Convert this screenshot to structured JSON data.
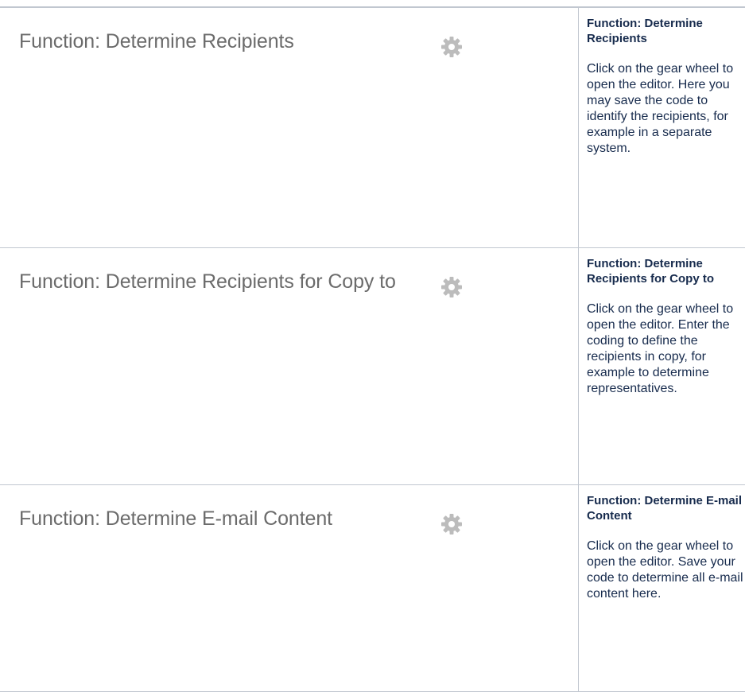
{
  "rows": [
    {
      "shot_label": "Function: Determine Recipients",
      "desc_title": "Function: Determine Recipients",
      "desc_body": "Click on the gear wheel to open the editor. Here you may save the code to identify the recipients, for example in a separate system."
    },
    {
      "shot_label": "Function: Determine Recipients for Copy to",
      "desc_title": "Function: Determine Recipients for Copy to",
      "desc_body": "Click on the gear wheel to open the editor. Enter the coding to define the recipients in copy, for example to determine representatives."
    },
    {
      "shot_label": "Function: Determine E-mail Content",
      "desc_title": "Function: Determine E-mail Content",
      "desc_body": "Click on the gear wheel to open the editor. Save your code to determine all e-mail content here."
    }
  ],
  "icons": {
    "gear": "gear-icon"
  },
  "colors": {
    "label_text": "#6b6b6b",
    "gear": "#bcbcbc",
    "body_text": "#172b4d",
    "border": "#c1c7d0"
  }
}
